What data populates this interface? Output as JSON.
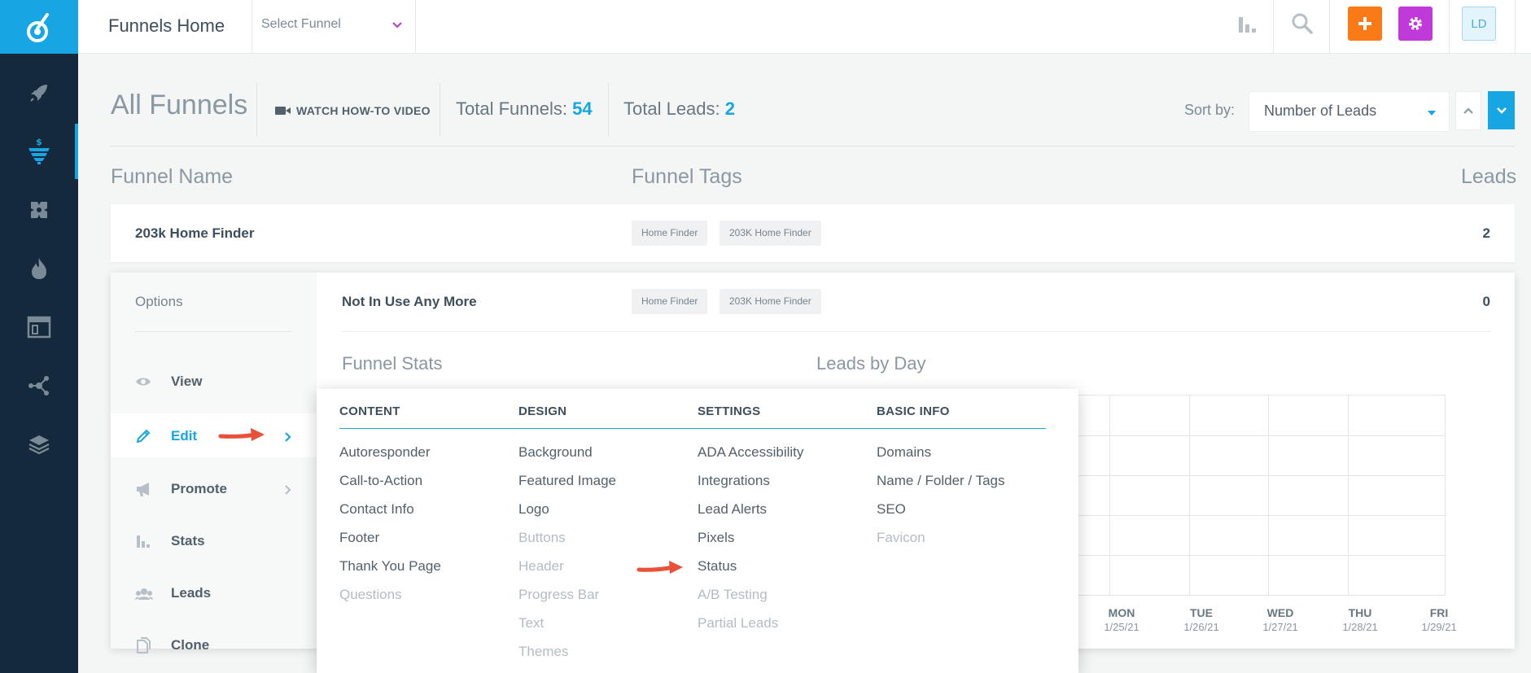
{
  "topbar": {
    "title": "Funnels Home",
    "select_funnel": "Select Funnel",
    "avatar": "LD",
    "colors": {
      "add": "#f97a16",
      "settings": "#c039d9",
      "accent": "#16a6e3"
    }
  },
  "sidebar": {
    "items": [
      "rocket-icon",
      "funnel-icon",
      "puzzle-icon",
      "flame-icon",
      "browser-icon",
      "network-icon",
      "layers-icon"
    ],
    "active": "funnel-icon"
  },
  "header": {
    "title": "All Funnels",
    "watch_video": "WATCH HOW-TO VIDEO",
    "total_funnels_label": "Total Funnels:",
    "total_funnels_value": "54",
    "total_leads_label": "Total Leads:",
    "total_leads_value": "2",
    "sort_label": "Sort by:",
    "sort_value": "Number of Leads"
  },
  "table": {
    "columns": {
      "name": "Funnel Name",
      "tags": "Funnel Tags",
      "leads": "Leads"
    },
    "rows": [
      {
        "name": "203k Home Finder",
        "tags": [
          "Home Finder",
          "203K Home Finder"
        ],
        "leads": "2"
      },
      {
        "name": "Not In Use Any More",
        "tags": [
          "Home Finder",
          "203K Home Finder"
        ],
        "leads": "0"
      }
    ]
  },
  "options": {
    "title": "Options",
    "items": [
      {
        "label": "View",
        "icon": "eye-icon"
      },
      {
        "label": "Edit",
        "icon": "pencil-icon",
        "active": true
      },
      {
        "label": "Promote",
        "icon": "megaphone-icon"
      },
      {
        "label": "Stats",
        "icon": "bar-chart-icon"
      },
      {
        "label": "Leads",
        "icon": "users-icon"
      },
      {
        "label": "Clone",
        "icon": "copy-icon"
      }
    ]
  },
  "details": {
    "funnel_stats": "Funnel Stats",
    "leads_by_day": "Leads by Day",
    "days": [
      {
        "day": "MON",
        "date": "1/25/21"
      },
      {
        "day": "TUE",
        "date": "1/26/21"
      },
      {
        "day": "WED",
        "date": "1/27/21"
      },
      {
        "day": "THU",
        "date": "1/28/21"
      },
      {
        "day": "FRI",
        "date": "1/29/21"
      }
    ]
  },
  "edit_menu": {
    "columns": [
      {
        "heading": "CONTENT",
        "items": [
          {
            "label": "Autoresponder",
            "enabled": true
          },
          {
            "label": "Call-to-Action",
            "enabled": true
          },
          {
            "label": "Contact Info",
            "enabled": true
          },
          {
            "label": "Footer",
            "enabled": true
          },
          {
            "label": "Thank You Page",
            "enabled": true
          },
          {
            "label": "Questions",
            "enabled": false
          }
        ]
      },
      {
        "heading": "DESIGN",
        "items": [
          {
            "label": "Background",
            "enabled": true
          },
          {
            "label": "Featured Image",
            "enabled": true
          },
          {
            "label": "Logo",
            "enabled": true
          },
          {
            "label": "Buttons",
            "enabled": false
          },
          {
            "label": "Header",
            "enabled": false
          },
          {
            "label": "Progress Bar",
            "enabled": false
          },
          {
            "label": "Text",
            "enabled": false
          },
          {
            "label": "Themes",
            "enabled": false
          }
        ]
      },
      {
        "heading": "SETTINGS",
        "items": [
          {
            "label": "ADA Accessibility",
            "enabled": true
          },
          {
            "label": "Integrations",
            "enabled": true
          },
          {
            "label": "Lead Alerts",
            "enabled": true
          },
          {
            "label": "Pixels",
            "enabled": true
          },
          {
            "label": "Status",
            "enabled": true
          },
          {
            "label": "A/B Testing",
            "enabled": false
          },
          {
            "label": "Partial Leads",
            "enabled": false
          }
        ]
      },
      {
        "heading": "BASIC INFO",
        "items": [
          {
            "label": "Domains",
            "enabled": true
          },
          {
            "label": "Name / Folder / Tags",
            "enabled": true
          },
          {
            "label": "SEO",
            "enabled": true
          },
          {
            "label": "Favicon",
            "enabled": false
          }
        ]
      }
    ]
  }
}
